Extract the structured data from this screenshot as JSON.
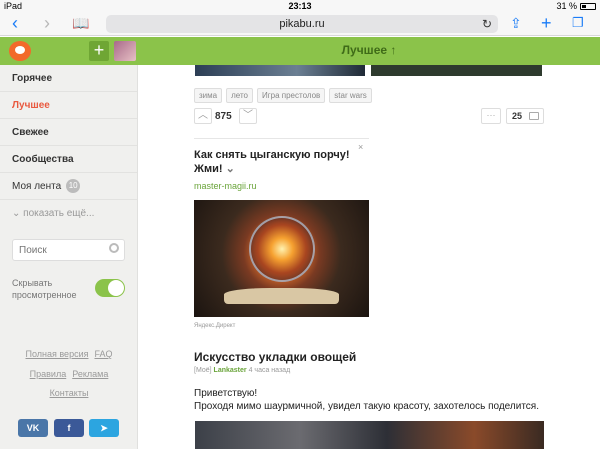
{
  "status": {
    "device": "iPad",
    "time": "23:13",
    "battery": "31 %"
  },
  "browser": {
    "url": "pikabu.ru"
  },
  "header": {
    "title": "Лучшее ↑"
  },
  "sidebar": {
    "items": [
      {
        "label": "Горячее"
      },
      {
        "label": "Лучшее"
      },
      {
        "label": "Свежее"
      },
      {
        "label": "Сообщества"
      },
      {
        "label": "Моя лента",
        "badge": "10"
      }
    ],
    "more": "показать ещё...",
    "search_placeholder": "Поиск",
    "toggle_label": "Скрывать просмотренное",
    "links_row1": [
      "Полная версия",
      "FAQ"
    ],
    "links_row2": [
      "Правила",
      "Реклама"
    ],
    "links_row3": [
      "Контакты"
    ],
    "social": [
      "вк",
      "f",
      "telegram"
    ]
  },
  "post1": {
    "tags": [
      "зима",
      "лето",
      "Игра престолов",
      "star wars"
    ],
    "rating": "875",
    "comments": "25"
  },
  "ad": {
    "title": "Как снять цыганскую порчу! Жми!",
    "link": "master-magii.ru",
    "note": "Яндекс.Директ"
  },
  "post2": {
    "title": "Искусство укладки овощей",
    "community": "[Моё]",
    "author": "Lankaster",
    "time": "4 часа назад",
    "text1": "Приветствую!",
    "text2": "Проходя мимо шаурмичной, увидел такую красоту, захотелось поделится."
  },
  "colors": {
    "accent": "#8bc34a",
    "active": "#e9593f",
    "link": "#6aa43a"
  }
}
